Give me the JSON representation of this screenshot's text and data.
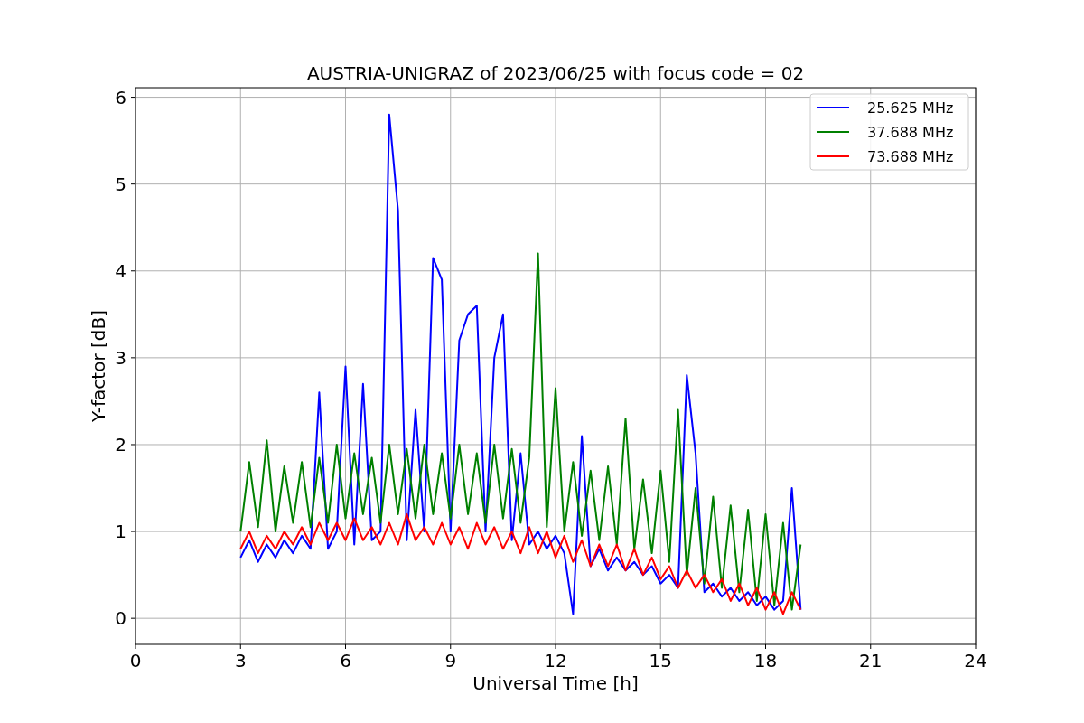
{
  "chart_data": {
    "type": "line",
    "title": "AUSTRIA-UNIGRAZ of 2023/06/25 with focus code = 02",
    "xlabel": "Universal Time [h]",
    "ylabel": "Y-factor [dB]",
    "x": [
      3,
      3.25,
      3.5,
      3.75,
      4,
      4.25,
      4.5,
      4.75,
      5,
      5.25,
      5.5,
      5.75,
      6,
      6.25,
      6.5,
      6.75,
      7,
      7.25,
      7.5,
      7.75,
      8,
      8.25,
      8.5,
      8.75,
      9,
      9.25,
      9.5,
      9.75,
      10,
      10.25,
      10.5,
      10.75,
      11,
      11.25,
      11.5,
      11.75,
      12,
      12.25,
      12.5,
      12.75,
      13,
      13.25,
      13.5,
      13.75,
      14,
      14.25,
      14.5,
      14.75,
      15,
      15.25,
      15.5,
      15.75,
      16,
      16.25,
      16.5,
      16.75,
      17,
      17.25,
      17.5,
      17.75,
      18,
      18.25,
      18.5,
      18.75,
      19
    ],
    "series": [
      {
        "name": "25.625 MHz",
        "color": "#0000ff",
        "values": [
          0.7,
          0.9,
          0.65,
          0.85,
          0.7,
          0.9,
          0.75,
          0.95,
          0.8,
          2.6,
          0.8,
          1.0,
          2.9,
          0.85,
          2.7,
          0.9,
          1.0,
          5.8,
          4.7,
          0.9,
          2.4,
          1.0,
          4.15,
          3.9,
          1.0,
          3.2,
          3.5,
          3.6,
          1.0,
          3.0,
          3.5,
          0.9,
          1.9,
          0.85,
          1.0,
          0.8,
          0.95,
          0.75,
          0.05,
          2.1,
          0.6,
          0.8,
          0.55,
          0.7,
          0.55,
          0.65,
          0.5,
          0.6,
          0.4,
          0.5,
          0.35,
          2.8,
          1.9,
          0.3,
          0.4,
          0.25,
          0.35,
          0.2,
          0.3,
          0.15,
          0.25,
          0.1,
          0.2,
          1.5,
          0.1
        ]
      },
      {
        "name": "37.688 MHz",
        "color": "#008000",
        "values": [
          1.0,
          1.8,
          1.05,
          2.05,
          1.0,
          1.75,
          1.1,
          1.8,
          1.05,
          1.85,
          1.1,
          2.0,
          1.15,
          1.9,
          1.2,
          1.85,
          1.1,
          2.0,
          1.2,
          1.95,
          1.15,
          2.0,
          1.2,
          1.9,
          1.15,
          2.0,
          1.2,
          1.9,
          1.1,
          2.0,
          1.15,
          1.95,
          1.1,
          1.85,
          4.2,
          1.05,
          2.65,
          1.0,
          1.8,
          0.95,
          1.7,
          0.9,
          1.75,
          0.85,
          2.3,
          0.8,
          1.6,
          0.75,
          1.7,
          0.65,
          2.4,
          0.5,
          1.5,
          0.4,
          1.4,
          0.35,
          1.3,
          0.3,
          1.25,
          0.2,
          1.2,
          0.15,
          1.1,
          0.1,
          0.85
        ]
      },
      {
        "name": "73.688 MHz",
        "color": "#ff0000",
        "values": [
          0.8,
          1.0,
          0.75,
          0.95,
          0.8,
          1.0,
          0.85,
          1.05,
          0.85,
          1.1,
          0.9,
          1.1,
          0.9,
          1.15,
          0.9,
          1.05,
          0.85,
          1.1,
          0.85,
          1.2,
          0.9,
          1.05,
          0.85,
          1.1,
          0.85,
          1.05,
          0.8,
          1.1,
          0.85,
          1.05,
          0.8,
          1.0,
          0.75,
          1.05,
          0.75,
          1.0,
          0.7,
          0.95,
          0.65,
          0.9,
          0.6,
          0.85,
          0.6,
          0.85,
          0.55,
          0.8,
          0.5,
          0.7,
          0.45,
          0.6,
          0.35,
          0.55,
          0.35,
          0.5,
          0.3,
          0.45,
          0.2,
          0.4,
          0.15,
          0.35,
          0.1,
          0.3,
          0.05,
          0.3,
          0.1
        ]
      }
    ],
    "xlim": [
      0,
      24
    ],
    "ylim": [
      -0.3,
      6.11
    ],
    "xticks": [
      0,
      3,
      6,
      9,
      12,
      15,
      18,
      21,
      24
    ],
    "yticks": [
      0,
      1,
      2,
      3,
      4,
      5,
      6
    ],
    "grid": true,
    "legend": "upper right"
  }
}
